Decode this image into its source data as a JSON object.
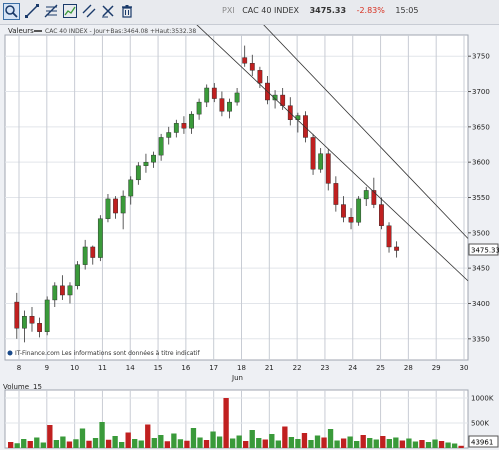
{
  "toolbar": {
    "tools": [
      "pointer-tool",
      "line-tool",
      "fibonacci-tool",
      "zoom-chart-tool",
      "parallel-channel-tool",
      "clear-tool",
      "delete-tool"
    ]
  },
  "header": {
    "market": "PXI",
    "instrument": "CAC 40 INDEX",
    "last": "3475.33",
    "change": "-2.83%",
    "time": "15:05"
  },
  "colors": {
    "up": "#3a9a3a",
    "down": "#c02020",
    "accent": "#1a4a8a",
    "change": "#d83020"
  },
  "chart_data": [
    {
      "type": "candlestick",
      "panel_label": "Valeurs",
      "legend": "CAC 40 INDEX - Jour+Bas:3464.08 +Haut:3532.38",
      "attribution": "IT-Finance.com Les informations sont données à titre indicatif",
      "last_price_label": "3475.33",
      "x_ticks": [
        "8",
        "9",
        "10",
        "11",
        "14",
        "15",
        "16",
        "17",
        "18",
        "21",
        "22",
        "23",
        "24",
        "25",
        "28",
        "29",
        "30"
      ],
      "x_month": "Jun",
      "y_ticks": [
        "3750",
        "3700",
        "3650",
        "3600",
        "3550",
        "3500",
        "3450",
        "3400",
        "3350"
      ],
      "ylim": [
        3320,
        3780
      ],
      "grid": true,
      "ohlc": [
        [
          3402,
          3415,
          3350,
          3365
        ],
        [
          3365,
          3390,
          3345,
          3382
        ],
        [
          3382,
          3395,
          3360,
          3372
        ],
        [
          3372,
          3380,
          3352,
          3360
        ],
        [
          3360,
          3410,
          3355,
          3405
        ],
        [
          3405,
          3430,
          3395,
          3425
        ],
        [
          3425,
          3440,
          3405,
          3412
        ],
        [
          3412,
          3430,
          3400,
          3425
        ],
        [
          3425,
          3460,
          3420,
          3455
        ],
        [
          3455,
          3490,
          3448,
          3480
        ],
        [
          3480,
          3482,
          3455,
          3465
        ],
        [
          3465,
          3525,
          3460,
          3520
        ],
        [
          3520,
          3555,
          3515,
          3548
        ],
        [
          3548,
          3552,
          3520,
          3528
        ],
        [
          3528,
          3560,
          3505,
          3552
        ],
        [
          3552,
          3580,
          3540,
          3575
        ],
        [
          3575,
          3600,
          3568,
          3595
        ],
        [
          3595,
          3612,
          3585,
          3600
        ],
        [
          3600,
          3615,
          3592,
          3610
        ],
        [
          3610,
          3640,
          3602,
          3635
        ],
        [
          3635,
          3650,
          3625,
          3642
        ],
        [
          3642,
          3660,
          3635,
          3655
        ],
        [
          3655,
          3665,
          3640,
          3648
        ],
        [
          3648,
          3672,
          3640,
          3668
        ],
        [
          3668,
          3690,
          3660,
          3685
        ],
        [
          3685,
          3710,
          3678,
          3705
        ],
        [
          3705,
          3712,
          3685,
          3690
        ],
        [
          3690,
          3700,
          3665,
          3672
        ],
        [
          3672,
          3690,
          3662,
          3685
        ],
        [
          3685,
          3705,
          3680,
          3698
        ],
        [
          3748,
          3765,
          3735,
          3740
        ],
        [
          3740,
          3752,
          3722,
          3730
        ],
        [
          3730,
          3735,
          3705,
          3712
        ],
        [
          3712,
          3722,
          3682,
          3688
        ],
        [
          3688,
          3702,
          3676,
          3695
        ],
        [
          3695,
          3705,
          3674,
          3680
        ],
        [
          3680,
          3692,
          3652,
          3660
        ],
        [
          3660,
          3670,
          3642,
          3666
        ],
        [
          3666,
          3672,
          3628,
          3635
        ],
        [
          3635,
          3640,
          3582,
          3590
        ],
        [
          3590,
          3620,
          3585,
          3612
        ],
        [
          3612,
          3618,
          3560,
          3570
        ],
        [
          3570,
          3580,
          3530,
          3540
        ],
        [
          3540,
          3552,
          3515,
          3522
        ],
        [
          3522,
          3535,
          3505,
          3515
        ],
        [
          3515,
          3552,
          3510,
          3548
        ],
        [
          3548,
          3565,
          3538,
          3560
        ],
        [
          3560,
          3578,
          3535,
          3540
        ],
        [
          3540,
          3550,
          3505,
          3510
        ],
        [
          3510,
          3515,
          3472,
          3480
        ],
        [
          3480,
          3488,
          3465,
          3475
        ]
      ],
      "channel_lines": [
        {
          "start": [
            0,
            3905
          ],
          "end": [
            57,
            3492
          ]
        },
        {
          "start": [
            0,
            3805
          ],
          "end": [
            57,
            3432
          ]
        }
      ]
    },
    {
      "type": "bar",
      "panel_label": "Volume",
      "period": "15",
      "y_ticks": [
        "1000K",
        "500K"
      ],
      "last_value_label": "43961",
      "values": [
        120,
        95,
        180,
        140,
        210,
        110,
        460,
        160,
        230,
        130,
        175,
        390,
        145,
        200,
        520,
        165,
        240,
        120,
        310,
        180,
        150,
        470,
        200,
        260,
        135,
        290,
        175,
        145,
        400,
        210,
        160,
        330,
        230,
        1000,
        190,
        250,
        140,
        360,
        200,
        170,
        280,
        150,
        430,
        220,
        180,
        300,
        160,
        250,
        210,
        380,
        150,
        190,
        230,
        140,
        260,
        200,
        170,
        240,
        180,
        210,
        150,
        190,
        130,
        160,
        120,
        170,
        140,
        110,
        90,
        43.961
      ],
      "ylim": [
        0,
        1100
      ]
    }
  ]
}
